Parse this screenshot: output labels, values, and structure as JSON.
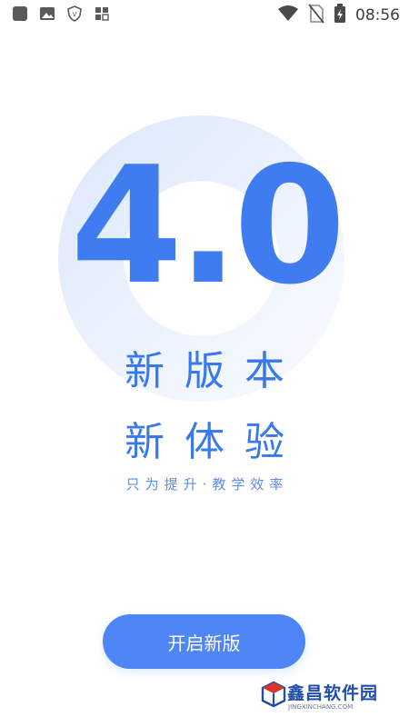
{
  "status_bar": {
    "time": "08:56",
    "icons": [
      "app-square-icon",
      "image-icon",
      "shield-icon",
      "grid-icon",
      "wifi-icon",
      "no-sim-icon",
      "battery-charging-icon"
    ]
  },
  "splash": {
    "version": "4.0",
    "headline_1": "新版本",
    "headline_2": "新体验",
    "tagline": "只为提升·教学效率",
    "start_button": "开启新版"
  },
  "watermark": {
    "logo_text": "鑫昌软件园",
    "logo_sub": "JINGXINCHANG.COM"
  },
  "colors": {
    "accent": "#3a78ee",
    "button": "#4e86f6"
  }
}
